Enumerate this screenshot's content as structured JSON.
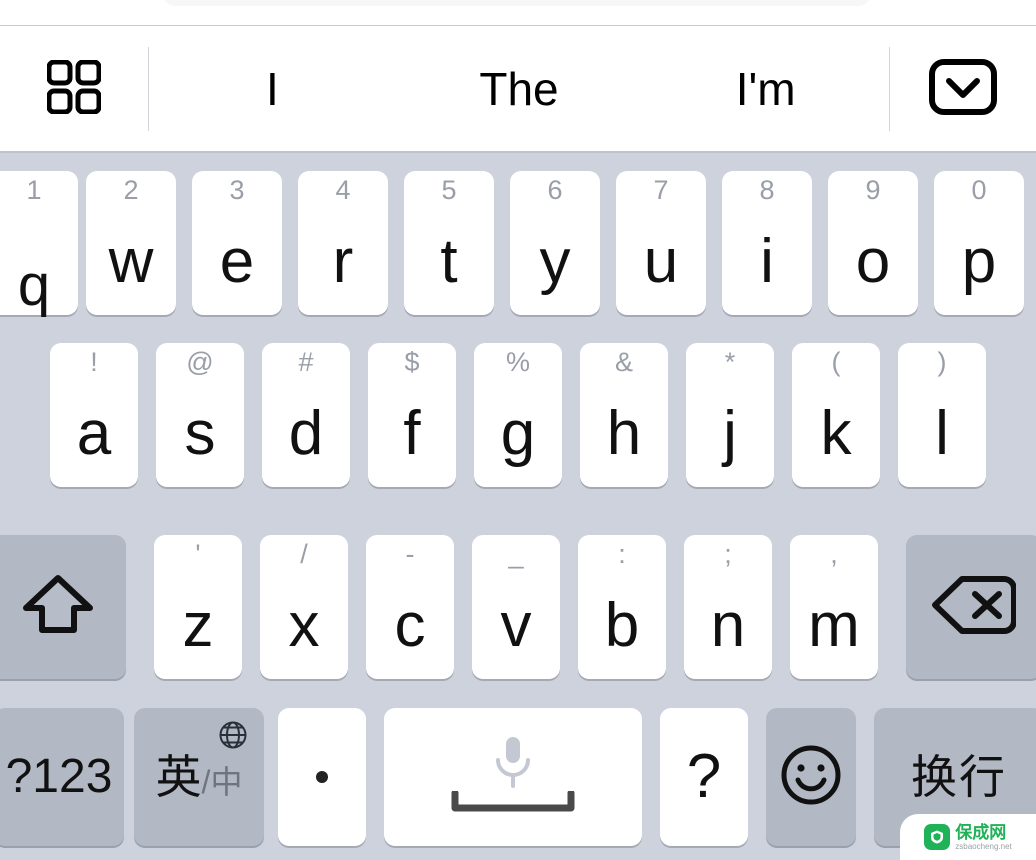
{
  "suggestion_bar": {
    "grid_icon": "grid-four-squares-icon",
    "words": [
      "I",
      "The",
      "I'm"
    ],
    "dismiss_icon": "dismiss-keyboard-chevron-down-icon"
  },
  "colors": {
    "keyboard_background": "#ced2dc",
    "key_light": "#ffffff",
    "key_dark": "#b2b8c4",
    "alt_label": "#9a9ea8",
    "main_label": "#111111",
    "watermark_green": "#1fb256"
  },
  "keyboard": {
    "row1": [
      {
        "main": "q",
        "alt": "1"
      },
      {
        "main": "w",
        "alt": "2"
      },
      {
        "main": "e",
        "alt": "3"
      },
      {
        "main": "r",
        "alt": "4"
      },
      {
        "main": "t",
        "alt": "5"
      },
      {
        "main": "y",
        "alt": "6"
      },
      {
        "main": "u",
        "alt": "7"
      },
      {
        "main": "i",
        "alt": "8"
      },
      {
        "main": "o",
        "alt": "9"
      },
      {
        "main": "p",
        "alt": "0"
      }
    ],
    "row2": [
      {
        "main": "a",
        "alt": "!"
      },
      {
        "main": "s",
        "alt": "@"
      },
      {
        "main": "d",
        "alt": "#"
      },
      {
        "main": "f",
        "alt": "$"
      },
      {
        "main": "g",
        "alt": "%"
      },
      {
        "main": "h",
        "alt": "&"
      },
      {
        "main": "j",
        "alt": "*"
      },
      {
        "main": "k",
        "alt": "("
      },
      {
        "main": "l",
        "alt": ")"
      }
    ],
    "row3": {
      "shift_icon": "shift-arrow-up-icon",
      "keys": [
        {
          "main": "z",
          "alt": "'"
        },
        {
          "main": "x",
          "alt": "/"
        },
        {
          "main": "c",
          "alt": "-"
        },
        {
          "main": "v",
          "alt": "_"
        },
        {
          "main": "b",
          "alt": ":"
        },
        {
          "main": "n",
          "alt": ";"
        },
        {
          "main": "m",
          "alt": ","
        }
      ],
      "backspace_icon": "backspace-delete-icon"
    },
    "row4": {
      "numeric_label": "?123",
      "lang_label": "英",
      "lang_sep": "/",
      "lang_sub_label": "中",
      "globe_icon": "globe-language-icon",
      "period_label": ".",
      "space_mic_icon": "microphone-icon",
      "space_glyph_icon": "space-bar-icon",
      "question_label": "?",
      "emoji_icon": "smiley-face-emoji-icon",
      "return_label": "换行"
    }
  },
  "watermark": {
    "site_name": "保成网",
    "url": "zsbaocheng.net"
  }
}
